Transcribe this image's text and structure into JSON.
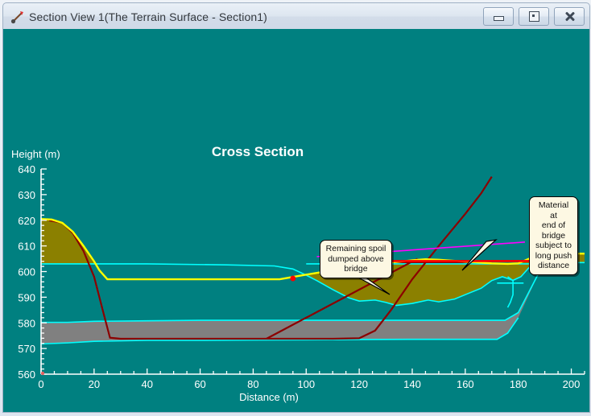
{
  "window": {
    "title": "Section View 1(The Terrain Surface - Section1)",
    "icon": "section-tool-icon",
    "buttons": [
      {
        "name": "minimize",
        "label": "Minimize"
      },
      {
        "name": "maximize",
        "label": "Maximize"
      },
      {
        "name": "close",
        "label": "Close"
      }
    ]
  },
  "colors": {
    "background": "#008080",
    "design_line": "#ffff00",
    "existing_line": "#8b0000",
    "terrain_line": "#00ffff",
    "fill_cut": "#8b8000",
    "fill_spoil": "#8b0000",
    "stratum": "#808080",
    "leader": "#ff00ff",
    "arrow": "#ff0000",
    "axis": "#ffffff",
    "marker": "#ff0000"
  },
  "chart_data": {
    "type": "area",
    "title": "Cross Section",
    "xlabel": "Distance (m)",
    "ylabel": "Height (m)",
    "xlim": [
      0,
      205
    ],
    "ylim": [
      560,
      640
    ],
    "xticks": [
      0,
      20,
      40,
      60,
      80,
      100,
      120,
      140,
      160,
      180,
      200
    ],
    "yticks": [
      560,
      570,
      580,
      590,
      600,
      610,
      620,
      630,
      640
    ],
    "x_minor_step": 5,
    "y_minor_step": 2,
    "grid": false,
    "legend": "none",
    "series": [
      {
        "name": "Design surface (yellow)",
        "color": "#ffff00",
        "x": [
          0,
          4,
          8,
          12,
          16,
          20,
          22,
          25,
          30,
          60,
          90,
          100,
          110,
          120,
          130,
          140,
          145,
          150,
          160,
          170,
          176,
          180,
          184,
          188,
          192,
          200,
          205
        ],
        "y": [
          620.5,
          620.3,
          619.0,
          615.5,
          610.0,
          604.0,
          600.5,
          597.0,
          597.0,
          597.0,
          597.0,
          598.8,
          600.5,
          602.0,
          603.3,
          604.4,
          604.8,
          604.6,
          603.9,
          603.2,
          603.0,
          603.2,
          605.0,
          606.4,
          606.9,
          607.0,
          607.0
        ]
      },
      {
        "name": "Existing ground / bridge deck (dark red)",
        "color": "#8b0000",
        "x": [
          3,
          8,
          12,
          16,
          20,
          24,
          26,
          30,
          60,
          90,
          110,
          120,
          126,
          132,
          140,
          150,
          160,
          166,
          170
        ],
        "y": [
          620.0,
          619.0,
          615.0,
          608.0,
          598.0,
          582.0,
          574.2,
          573.8,
          573.8,
          573.8,
          573.8,
          574.0,
          577.0,
          585.0,
          597.0,
          610.0,
          622.5,
          630.5,
          637.0
        ]
      },
      {
        "name": "Terrain surface upper (cyan)",
        "color": "#00ffff",
        "x": [
          0,
          10,
          14,
          18,
          40,
          70,
          88,
          95,
          100,
          104,
          110,
          116,
          120,
          126,
          130,
          134,
          140,
          146,
          150,
          156,
          160,
          166,
          170,
          174,
          178,
          181,
          184,
          188,
          194,
          200,
          205
        ],
        "y": [
          603.0,
          603.0,
          603.0,
          603.0,
          603.0,
          602.6,
          602.2,
          601.0,
          598.6,
          596.5,
          593.0,
          589.8,
          588.5,
          588.9,
          588.0,
          586.8,
          587.6,
          588.9,
          588.2,
          589.3,
          591.0,
          593.5,
          596.5,
          598.0,
          596.6,
          598.0,
          601.5,
          603.5,
          603.5,
          603.5,
          603.5
        ]
      },
      {
        "name": "Stratum top (cyan)",
        "color": "#00ffff",
        "x": [
          0,
          10,
          20,
          40,
          60,
          80,
          100,
          120,
          140,
          160,
          175,
          180,
          184,
          188
        ],
        "y": [
          580.2,
          580.2,
          580.6,
          580.8,
          581.0,
          581.0,
          581.0,
          581.0,
          581.0,
          581.0,
          581.0,
          584.0,
          592.0,
          600.0
        ]
      },
      {
        "name": "Stratum bottom (cyan)",
        "color": "#00ffff",
        "x": [
          0,
          10,
          20,
          40,
          60,
          80,
          100,
          120,
          140,
          160,
          172,
          176,
          180
        ],
        "y": [
          571.8,
          572.2,
          572.8,
          573.2,
          573.2,
          573.3,
          573.4,
          573.5,
          573.6,
          573.6,
          573.6,
          576.0,
          582.0
        ]
      }
    ],
    "annotations": [
      {
        "name": "callout-remaining-spoil",
        "text": "Remaining spoil dumped above bridge",
        "points_to": [
          140,
          604
        ]
      },
      {
        "name": "callout-material-end-of-bridge",
        "text": "Material at end of bridge subject to long push distance",
        "points_to": [
          182,
          603
        ]
      },
      {
        "name": "push-direction-arrow",
        "text": "",
        "points_to": [
          186,
          603
        ]
      },
      {
        "name": "station-marker",
        "text": "",
        "points_to": [
          95,
          597
        ]
      }
    ]
  },
  "callouts": {
    "left": {
      "lines": [
        "Remaining spoil",
        "dumped above",
        "bridge"
      ]
    },
    "right": {
      "lines": [
        "Material at",
        "end of",
        "bridge",
        "subject to",
        "long push",
        "distance"
      ]
    }
  }
}
